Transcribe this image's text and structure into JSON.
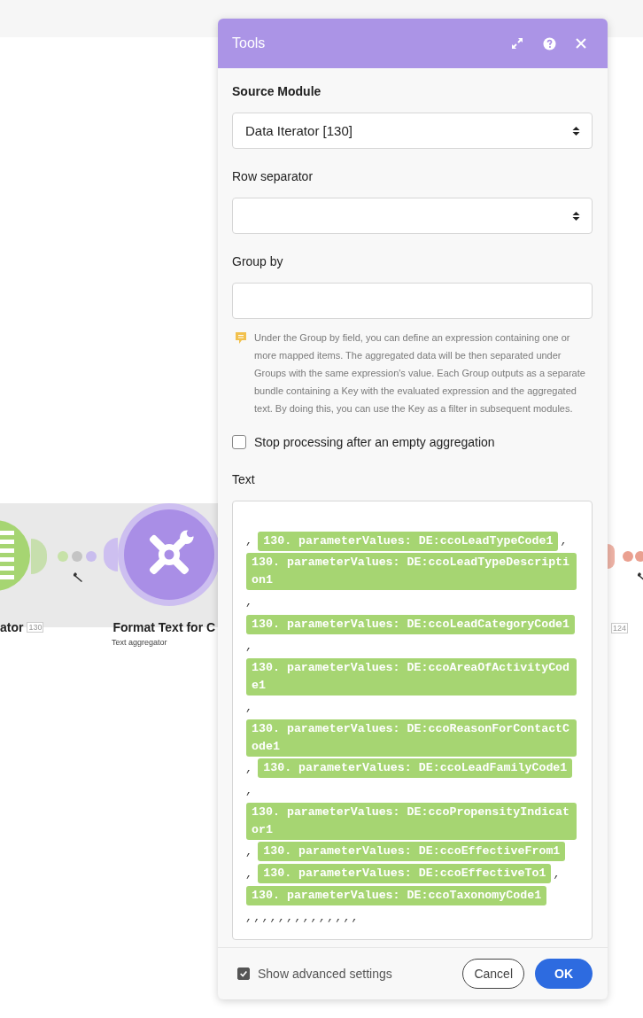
{
  "canvas": {
    "modules": [
      {
        "label": "ator",
        "badge": "130",
        "color": "#a6d572"
      },
      {
        "label": "Format Text for C",
        "subtitle": "Text aggregator",
        "color": "#a98ee6"
      },
      {
        "badge": "124",
        "color": "#eaa090"
      }
    ]
  },
  "panel": {
    "title": "Tools",
    "source_module": {
      "label": "Source Module",
      "value": "Data Iterator [130]"
    },
    "row_separator": {
      "label": "Row separator"
    },
    "group_by": {
      "label": "Group by",
      "hint": "Under the Group by field, you can define an expression containing one or more mapped items. The aggregated data will be then separated under Groups with the same expression's value. Each Group outputs as a separate bundle containing a Key with the evaluated expression and the aggregated text. By doing this, you can use the Key as a filter in subsequent modules."
    },
    "stop_processing": {
      "label": "Stop processing after an empty aggregation",
      "checked": false
    },
    "text": {
      "label": "Text",
      "tokens": [
        {
          "kind": "text",
          "text": ","
        },
        {
          "kind": "pill",
          "text": "130. parameterValues: DE:ccoLeadTypeCode1"
        },
        {
          "kind": "text",
          "text": ","
        },
        {
          "kind": "pill",
          "text": "130. parameterValues: DE:ccoLeadTypeDescription1"
        },
        {
          "kind": "text",
          "text": ","
        },
        {
          "kind": "pill",
          "text": "130. parameterValues: DE:ccoLeadCategoryCode1"
        },
        {
          "kind": "text",
          "text": ","
        },
        {
          "kind": "pill",
          "text": "130. parameterValues: DE:ccoAreaOfActivityCode1"
        },
        {
          "kind": "text",
          "text": ","
        },
        {
          "kind": "pill",
          "text": "130. parameterValues: DE:ccoReasonForContactCode1"
        },
        {
          "kind": "text",
          "text": ","
        },
        {
          "kind": "pill",
          "text": "130. parameterValues: DE:ccoLeadFamilyCode1"
        },
        {
          "kind": "text",
          "text": ","
        },
        {
          "kind": "pill",
          "text": "130. parameterValues: DE:ccoPropensityIndicator1"
        },
        {
          "kind": "text",
          "text": ","
        },
        {
          "kind": "pill",
          "text": "130. parameterValues: DE:ccoEffectiveFrom1"
        },
        {
          "kind": "text",
          "text": ","
        },
        {
          "kind": "pill",
          "text": "130. parameterValues: DE:ccoEffectiveTo1"
        },
        {
          "kind": "text",
          "text": ","
        },
        {
          "kind": "pill",
          "text": "130. parameterValues: DE:ccoTaxonomyCode1"
        },
        {
          "kind": "text",
          "text": ",,,,,,,,,,,,,,"
        }
      ]
    },
    "advanced": {
      "label": "Show advanced settings",
      "checked": true
    },
    "buttons": [
      {
        "label": "Cancel",
        "kind": "secondary"
      },
      {
        "label": "OK",
        "kind": "primary"
      }
    ]
  }
}
